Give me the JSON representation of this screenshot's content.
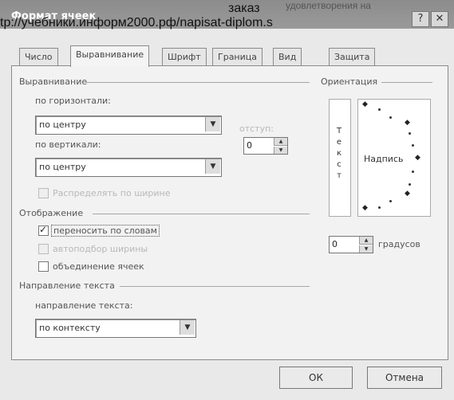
{
  "window": {
    "title": "Формат ячеек",
    "help_button": "?",
    "close_button": "✕"
  },
  "watermark": {
    "top_fragment": "удовлетворения на",
    "line1": "заказ",
    "line2": "tp://учебники.информ2000.рф/napisat-diplom.s"
  },
  "tabs": [
    "Число",
    "Выравнивание",
    "Шрифт",
    "Граница",
    "Вид",
    "Защита"
  ],
  "alignment": {
    "group_label": "Выравнивание",
    "horizontal_label": "по горизонтали:",
    "horizontal_value": "по центру",
    "vertical_label": "по вертикали:",
    "vertical_value": "по центру",
    "indent_label": "отступ:",
    "indent_value": "0",
    "distributed_label": "Распределять по ширине"
  },
  "display": {
    "group_label": "Отображение",
    "wrap_label": "переносить по словам",
    "wrap_checked": true,
    "shrink_label": "автоподбор ширины",
    "merge_label": "объединение ячеек"
  },
  "direction": {
    "group_label": "Направление текста",
    "label": "направление текста:",
    "value": "по контексту"
  },
  "orientation": {
    "group_label": "Ориентация",
    "vertical_text": [
      "Т",
      "е",
      "к",
      "с",
      "т"
    ],
    "caption": "Надпись",
    "degrees_value": "0",
    "degrees_label": "градусов"
  },
  "buttons": {
    "ok": "ОК",
    "cancel": "Отмена"
  },
  "colors": {
    "title_bar": "#8c8c8c",
    "panel": "#f2f2f2"
  }
}
